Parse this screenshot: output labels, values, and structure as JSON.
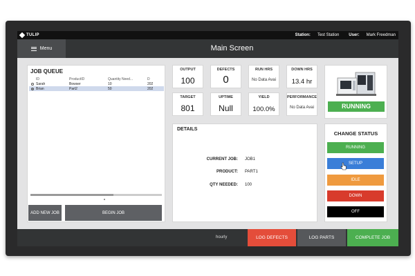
{
  "topbar": {
    "brand": "TULIP",
    "station_label": "Station:",
    "station_value": "Test Station",
    "user_label": "User:",
    "user_value": "Mark Freedman"
  },
  "header": {
    "menu_label": "Menu",
    "title": "Main Screen"
  },
  "job_queue": {
    "title": "JOB QUEUE",
    "columns": [
      "ID",
      "ProductID",
      "Quantity Need...",
      "D"
    ],
    "rows": [
      {
        "id": "Sarah",
        "product": "Bowser",
        "qty": "10",
        "extra": "202",
        "selected": false
      },
      {
        "id": "Brian",
        "product": "Part2",
        "qty": "50",
        "extra": "202",
        "selected": true
      }
    ],
    "add_job_label": "ADD NEW JOB",
    "begin_job_label": "BEGIN JOB"
  },
  "kpis": {
    "output": {
      "label": "OUTPUT",
      "value": "100"
    },
    "defects": {
      "label": "DEFECTS",
      "value": "0"
    },
    "run_hrs": {
      "label": "RUN HRS",
      "value": "No Data Avai"
    },
    "down_hrs": {
      "label": "DOWN HRS",
      "value": "13.4 hr"
    },
    "target": {
      "label": "TARGET",
      "value": "801"
    },
    "uptime": {
      "label": "UPTIME",
      "value": "Null"
    },
    "yield": {
      "label": "YIELD",
      "value": "100.0%"
    },
    "performance": {
      "label": "PERFORMANCE",
      "value": "No Data Avai"
    }
  },
  "machine": {
    "status": "RUNNING",
    "status_color": "#4caf50"
  },
  "details": {
    "title": "DETAILS",
    "current_job_label": "CURRENT JOB:",
    "current_job_value": "JOB1",
    "product_label": "PRODUCT:",
    "product_value": "PART1",
    "qty_label": "QTY NEEDED:",
    "qty_value": "100"
  },
  "change_status": {
    "title": "CHANGE STATUS",
    "running": {
      "label": "RUNNING",
      "color": "#4caf50"
    },
    "setup": {
      "label": "SETUP",
      "color": "#3a7ed8"
    },
    "idle": {
      "label": "IDLE",
      "color": "#ef9a3f"
    },
    "down": {
      "label": "DOWN",
      "color": "#d83b2c"
    },
    "off": {
      "label": "OFF",
      "color": "#000000"
    }
  },
  "bottombar": {
    "hourly_label": "hourly",
    "log_defects": "LOG DEFECTS",
    "log_parts": "LOG PARTS",
    "complete_job": "COMPLETE JOB"
  }
}
